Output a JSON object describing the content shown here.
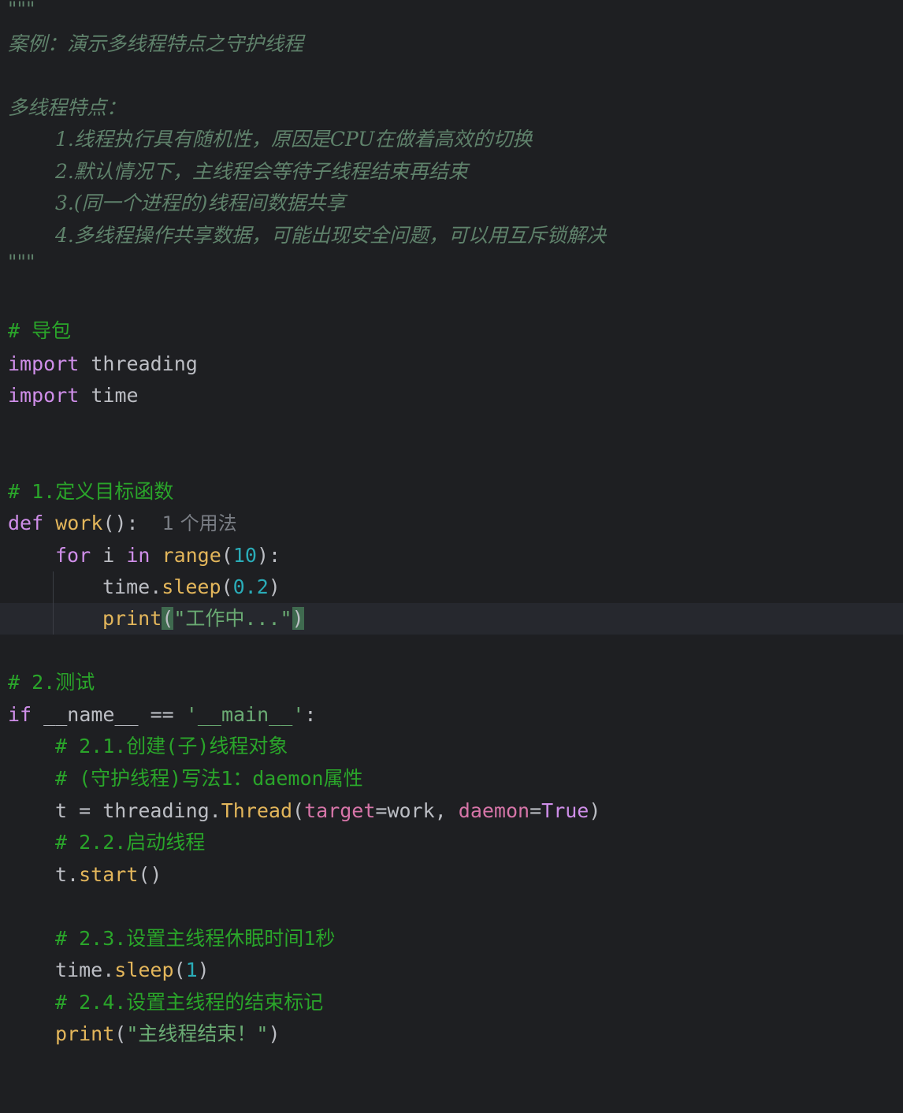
{
  "docstring": {
    "open": "\"\"\"",
    "title": "案例：演示多线程特点之守护线程",
    "subtitle": "多线程特点：",
    "points": [
      "1.线程执行具有随机性，原因是CPU在做着高效的切换",
      "2.默认情况下，主线程会等待子线程结束再结束",
      "3.(同一个进程的)线程间数据共享",
      "4.多线程操作共享数据，可能出现安全问题，可以用互斥锁解决"
    ],
    "close": "\"\"\""
  },
  "imports": {
    "comment": "# 导包",
    "keyword": "import",
    "modules": [
      "threading",
      "time"
    ]
  },
  "work_fn": {
    "comment": "# 1.定义目标函数",
    "def_kw": "def",
    "name": "work",
    "signature_tail": "():",
    "usage_hint": "1 个用法",
    "for_kw": "for",
    "loop_var": "i",
    "in_kw": "in",
    "range_fn": "range",
    "range_arg": "10",
    "sleep_obj": "time.",
    "sleep_fn": "sleep",
    "sleep_arg": "0.2",
    "print_fn": "print",
    "print_arg": "\"工作中...\""
  },
  "main_block": {
    "comment": "# 2.测试",
    "if_kw": "if",
    "condition": "__name__ == ",
    "main_str": "'__main__'",
    "colon": ":",
    "c_create": "# 2.1.创建(子)线程对象",
    "c_daemon": "# (守护线程)写法1：daemon属性",
    "t_assign": "t = threading.",
    "thread_cls": "Thread",
    "target_kw": "target",
    "target_val": "=work, ",
    "daemon_kw": "daemon",
    "daemon_val": "True",
    "c_start": "# 2.2.启动线程",
    "start_obj": "t.",
    "start_fn": "start",
    "start_tail": "()",
    "c_sleep": "# 2.3.设置主线程休眠时间1秒",
    "sleep_obj": "time.",
    "sleep_fn": "sleep",
    "sleep_arg": "1",
    "c_end": "# 2.4.设置主线程的结束标记",
    "print_fn": "print",
    "print_arg": "\"主线程结束！\""
  },
  "colors": {
    "background": "#1e1f22",
    "current_line": "#26282e",
    "comment": "#2aa52a",
    "docstring": "#5f826b",
    "keyword": "#cf8ee9",
    "function": "#e3b65b",
    "number": "#2aacb8",
    "string": "#6aab73",
    "param": "#d675a8",
    "plain": "#bcbec4"
  }
}
